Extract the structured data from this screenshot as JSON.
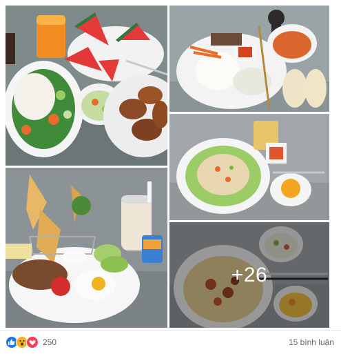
{
  "post": {
    "photos": [
      {
        "id": "p1",
        "icon": "food-photo-salad-noodles-watermelon"
      },
      {
        "id": "p2",
        "icon": "food-photo-rice-soup-pear"
      },
      {
        "id": "p3",
        "icon": "food-photo-fried-rice-cucumber"
      },
      {
        "id": "p4",
        "icon": "food-photo-bread-steak-egg"
      },
      {
        "id": "p5",
        "icon": "food-photo-pasta-more"
      }
    ],
    "more_count": "+26"
  },
  "footer": {
    "reactions": [
      "like-icon",
      "wow-icon",
      "love-icon"
    ],
    "reaction_count": "250",
    "comments_label": "15 bình luận"
  },
  "colors": {
    "like": "#1877f2",
    "love": "#f33e58",
    "wow": "#f7b125",
    "meta_text": "#606770"
  }
}
